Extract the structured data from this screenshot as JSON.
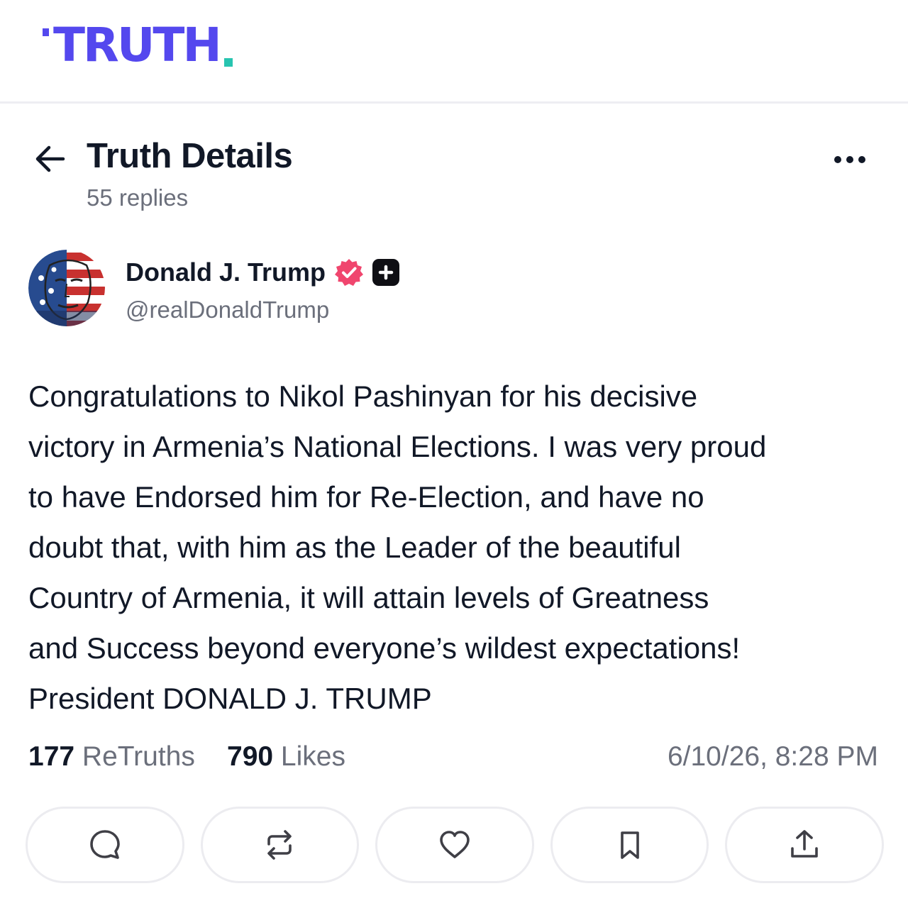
{
  "brand": {
    "logo_text": "TRUTH",
    "colors": {
      "primary": "#5448ee",
      "accent": "#27c4b0"
    }
  },
  "header": {
    "title": "Truth Details",
    "replies": "55 replies",
    "back_icon": "arrow-left-icon",
    "more_icon": "ellipsis-icon"
  },
  "author": {
    "display_name": "Donald J. Trump",
    "handle": "@realDonaldTrump",
    "verified_icon": "verified-badge-icon",
    "verified_color": "#f0466e",
    "plus_icon": "plus-badge-icon"
  },
  "post": {
    "lines": [
      "Congratulations to Nikol Pashinyan for his decisive",
      "victory in Armenia’s National Elections. I was very proud",
      "to have Endorsed him for Re-Election, and have no",
      "doubt that, with him as the Leader of the beautiful",
      "Country of Armenia, it will attain levels of Greatness",
      "and Success beyond everyone’s wildest expectations!",
      "President DONALD J. TRUMP"
    ]
  },
  "stats": {
    "retruths_count": "177",
    "retruths_label": "ReTruths",
    "likes_count": "790",
    "likes_label": "Likes",
    "timestamp": "6/10/26, 8:28 PM"
  },
  "actions": [
    {
      "name": "reply",
      "icon": "comment-icon"
    },
    {
      "name": "retruth",
      "icon": "retruth-icon"
    },
    {
      "name": "like",
      "icon": "heart-icon"
    },
    {
      "name": "bookmark",
      "icon": "bookmark-icon"
    },
    {
      "name": "share",
      "icon": "share-icon"
    }
  ]
}
